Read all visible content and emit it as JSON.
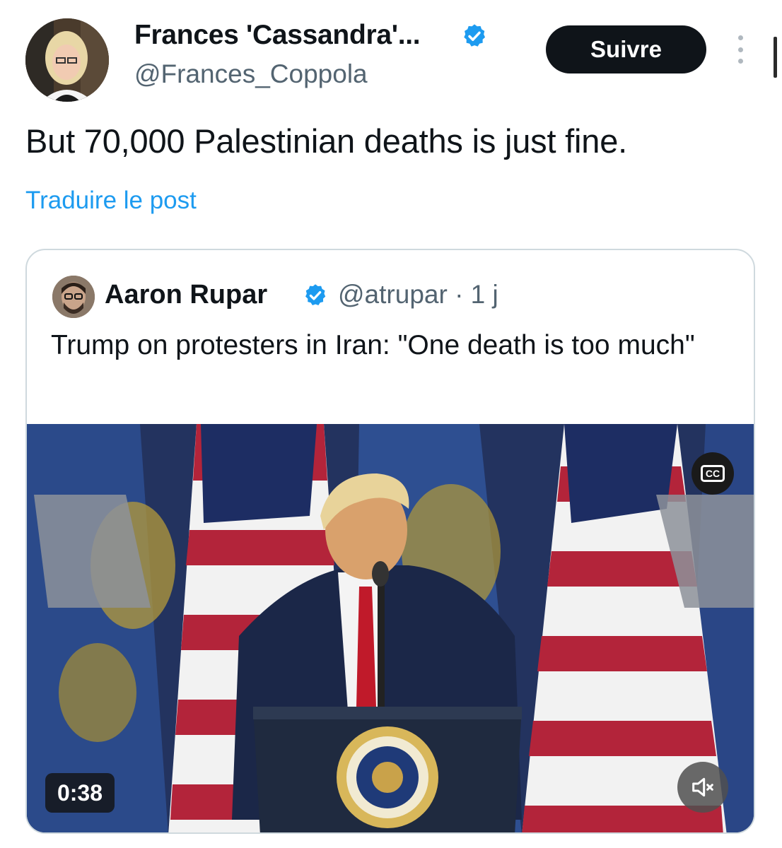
{
  "tweet": {
    "author_name": "Frances 'Cassandra'...",
    "author_handle": "@Frances_Coppola",
    "follow_label": "Suivre",
    "text": "But 70,000 Palestinian deaths is just fine.",
    "translate_label": "Traduire le post"
  },
  "quoted": {
    "author_name": "Aaron Rupar",
    "handle_time": "@atrupar · 1 j",
    "text": "Trump on protesters in Iran: \"One death is too much\"",
    "video": {
      "duration": "0:38",
      "cc_label": "CC"
    }
  },
  "colors": {
    "accent": "#1d9bf0",
    "text_primary": "#0f1419",
    "text_secondary": "#536471",
    "follow_bg": "#0f1419",
    "border": "#cfd9de"
  },
  "icons": [
    "verified-badge-icon",
    "more-options-icon",
    "closed-captions-icon",
    "muted-speaker-icon"
  ]
}
